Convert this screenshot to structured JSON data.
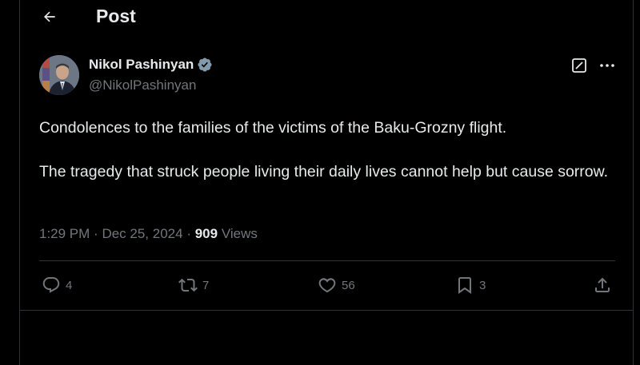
{
  "header": {
    "title": "Post",
    "back_icon": "arrow-left-icon"
  },
  "author": {
    "name": "Nikol Pashinyan",
    "handle": "@NikolPashinyan",
    "verified_color": "#829aab"
  },
  "tweet": {
    "paragraphs": [
      "Condolences to the families of the victims of the Baku-Grozny flight.",
      "The tragedy that struck people living their daily lives cannot help but cause sorrow."
    ],
    "time": "1:29 PM",
    "date": "Dec 25, 2024",
    "views_count": "909",
    "views_label": "Views"
  },
  "actions": {
    "replies": "4",
    "reposts": "7",
    "likes": "56",
    "bookmarks": "3"
  },
  "colors": {
    "background": "#000000",
    "text": "#e7e9ea",
    "muted": "#71767b",
    "border": "#2f3336"
  }
}
